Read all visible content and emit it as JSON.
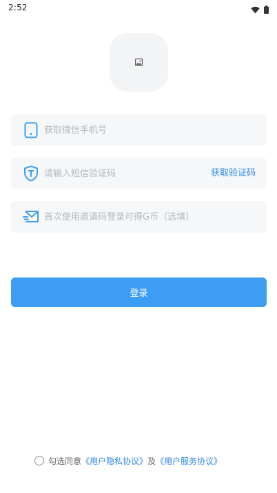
{
  "status_bar": {
    "time": "2:52",
    "icons": [
      "wifi-icon",
      "battery-icon"
    ]
  },
  "logo": {
    "icon": "image-placeholder-icon"
  },
  "phone_field": {
    "icon": "phone-icon",
    "placeholder": "获取微信手机号"
  },
  "sms_field": {
    "icon": "shield-t-icon",
    "placeholder": "请输入短信验证码",
    "action_label": "获取验证码"
  },
  "invite_field": {
    "icon": "envelope-icon",
    "placeholder": "首次使用邀请码登录可得G币（选填）"
  },
  "login_button": {
    "label": "登录"
  },
  "agreement": {
    "prefix": "勾选同意",
    "privacy_link": "《用户隐私协议》",
    "conjunction": "及",
    "service_link": "《用户服务协议》"
  },
  "colors": {
    "accent": "#3d9df5",
    "link": "#2f8ae8",
    "field_bg": "#f6f7f8"
  }
}
